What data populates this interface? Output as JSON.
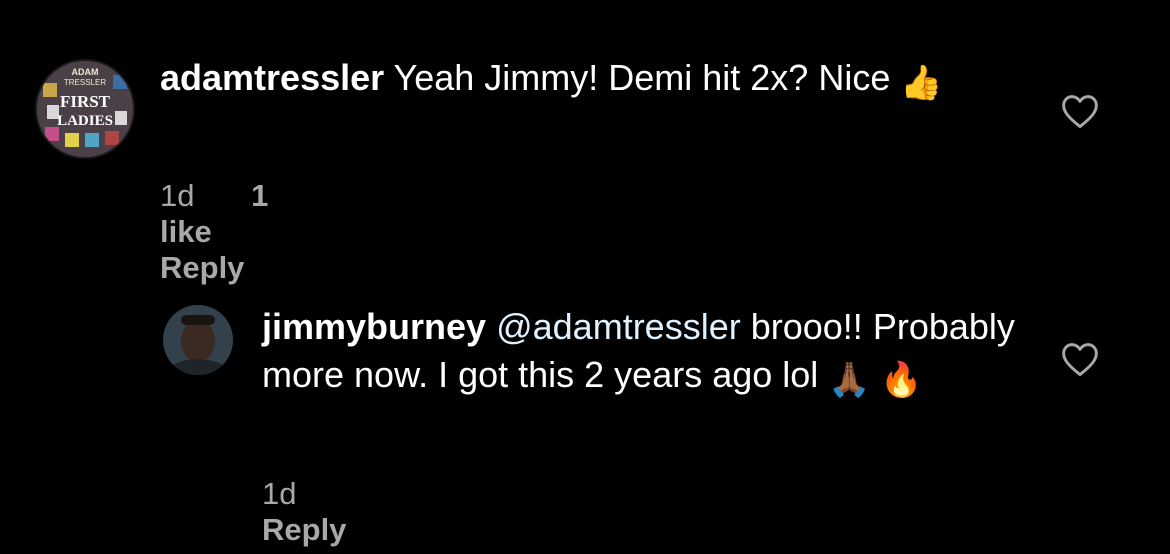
{
  "comments": [
    {
      "username": "adamtressler",
      "text": "Yeah Jimmy! Demi hit 2x? Nice",
      "emoji": "👍",
      "time": "1d",
      "likes": "1 like",
      "reply_label": "Reply",
      "avatar_text": [
        "ADAM",
        "TRESSLER",
        "FIRST",
        "LADIES"
      ]
    },
    {
      "username": "jimmyburney",
      "mention": "@adamtressler",
      "text": "brooo!! Probably more now. I got this 2 years ago lol",
      "emoji": "🙏🏾 🔥",
      "time": "1d",
      "reply_label": "Reply"
    }
  ],
  "colors": {
    "background": "#000000",
    "text": "#ffffff",
    "meta": "#a8a8a8",
    "mention": "#e0f1ff"
  },
  "icons": [
    "heart-icon"
  ]
}
